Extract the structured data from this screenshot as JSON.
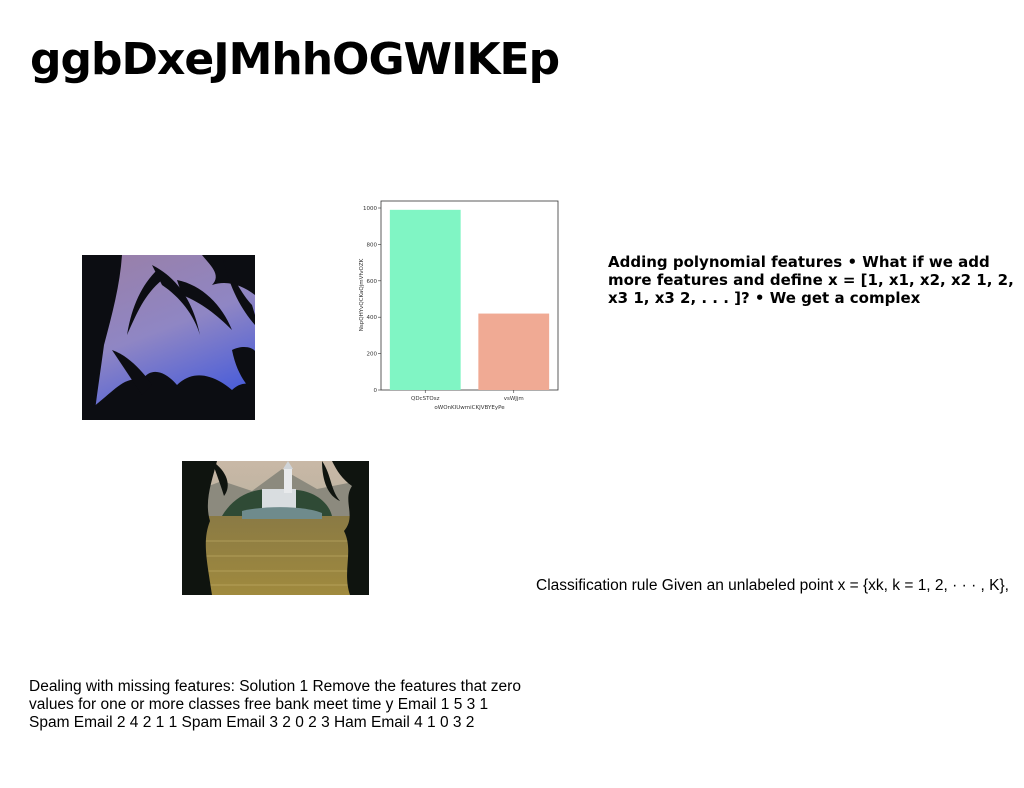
{
  "slide": {
    "title": "ggbDxeJMhhOGWIKEp",
    "paragraphs": {
      "polynomial": "Adding polynomial features • What if we add more features and define x = [1, x1, x2, x2 1, 2, x3 1, x3 2, . . . ]? • We get a complex",
      "classification": "Classification rule Given an unlabeled point x = {xk, k = 1, 2, · · · , K},",
      "missing": "Dealing with missing features: Solution 1 Remove the features that zero values for one or more classes free bank meet time y Email 1 5 3 1 Spam Email 2 4 2 1 1 Spam Email 3 2 0 2 3 Ham Email 4 1 0 3 2"
    },
    "images": {
      "palm": "palm-silhouette-photo",
      "lake": "lake-island-church-photo"
    }
  },
  "chart_data": {
    "type": "bar",
    "categories": [
      "QDcSTOsz",
      "vsWJjm"
    ],
    "values": [
      990,
      420
    ],
    "xlabel": "oWOnKIUwmiCKJVBYEyPe",
    "ylabel": "NspQHYvQCKaQjmVfvOZK",
    "ylim": [
      0,
      1000
    ],
    "yticks": [
      0,
      200,
      400,
      600,
      800,
      1000
    ],
    "colors": [
      "#80f5c4",
      "#f0aa94"
    ],
    "grid": false,
    "legend": "none"
  }
}
